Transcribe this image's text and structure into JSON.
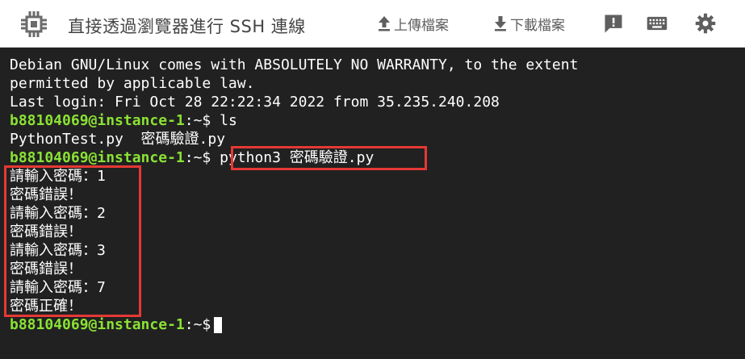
{
  "window": {
    "title": "直接透過瀏覽器進行 SSH 連線"
  },
  "toolbar": {
    "upload_label": "上傳檔案",
    "download_label": "下載檔案"
  },
  "icons": {
    "app": "chip-icon",
    "upload": "upload-arrow-icon",
    "download": "download-arrow-icon",
    "feedback": "feedback-icon",
    "keyboard": "keyboard-icon",
    "settings": "gear-icon"
  },
  "colors": {
    "terminal_bg": "#212121",
    "prompt_green": "#8ae234",
    "highlight_red": "#e53935",
    "toolbar_icon": "#5f5f5f"
  },
  "terminal": {
    "lines": [
      "Debian GNU/Linux comes with ABSOLUTELY NO WARRANTY, to the extent",
      "permitted by applicable law.",
      "Last login: Fri Oct 28 22:22:34 2022 from 35.235.240.208"
    ],
    "prompt_user": "b88104069@instance-1",
    "prompt_path": ":~$",
    "cmd1": "ls",
    "ls_output": "PythonTest.py  密碼驗證.py",
    "cmd2": "python3 密碼驗證.py",
    "program_output": [
      "請輸入密碼：1",
      "密碼錯誤！",
      "請輸入密碼：2",
      "密碼錯誤！",
      "請輸入密碼：3",
      "密碼錯誤！",
      "請輸入密碼：7",
      "密碼正確！"
    ]
  }
}
